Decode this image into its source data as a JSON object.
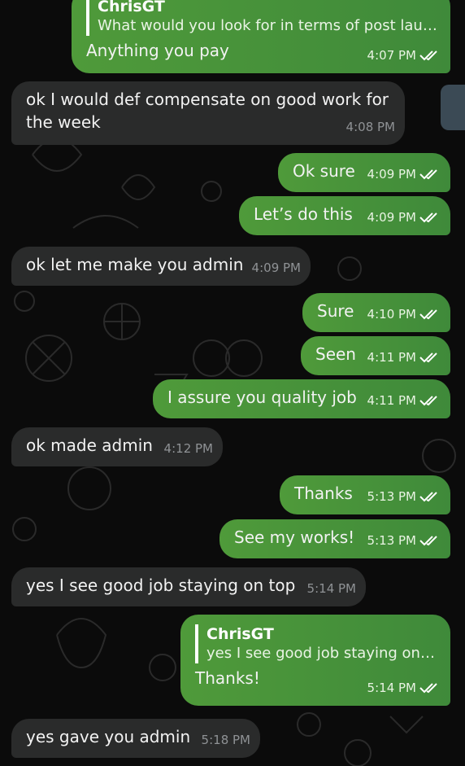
{
  "colors": {
    "outgoing": "#4a9638",
    "incoming": "#2a2b2b",
    "background": "#0b0b0b"
  },
  "messages": [
    {
      "direction": "out",
      "reply_name": "ChrisGT",
      "reply_text": "What would you look for in terms of post launc...",
      "text": "Anything you pay",
      "time": "4:07 PM",
      "status": "read"
    },
    {
      "direction": "in",
      "text": "ok I would def compensate on good work for the week",
      "time": "4:08 PM"
    },
    {
      "direction": "out",
      "text": "Ok sure",
      "time": "4:09 PM",
      "status": "read"
    },
    {
      "direction": "out",
      "text": "Let’s do this",
      "time": "4:09 PM",
      "status": "read"
    },
    {
      "direction": "in",
      "text": "ok let me make you admin",
      "time": "4:09 PM"
    },
    {
      "direction": "out",
      "text": "Sure",
      "time": "4:10 PM",
      "status": "read"
    },
    {
      "direction": "out",
      "text": "Seen",
      "time": "4:11 PM",
      "status": "read"
    },
    {
      "direction": "out",
      "text": "I assure you quality job",
      "time": "4:11 PM",
      "status": "read"
    },
    {
      "direction": "in",
      "text": "ok made admin",
      "time": "4:12 PM"
    },
    {
      "direction": "out",
      "text": "Thanks",
      "time": "5:13 PM",
      "status": "read"
    },
    {
      "direction": "out",
      "text": "See my works!",
      "time": "5:13 PM",
      "status": "read"
    },
    {
      "direction": "in",
      "text": "yes I see good job staying on top",
      "time": "5:14 PM"
    },
    {
      "direction": "out",
      "reply_name": "ChrisGT",
      "reply_text": "yes I see good job staying on top",
      "text": "Thanks!",
      "time": "5:14 PM",
      "status": "read"
    },
    {
      "direction": "in",
      "text": "yes gave you admin",
      "time": "5:18 PM"
    }
  ]
}
